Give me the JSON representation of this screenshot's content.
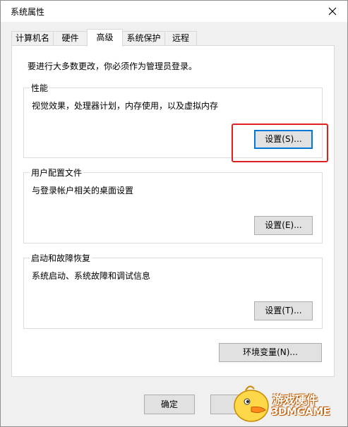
{
  "window": {
    "title": "系统属性"
  },
  "tabs": [
    {
      "label": "计算机名"
    },
    {
      "label": "硬件"
    },
    {
      "label": "高级"
    },
    {
      "label": "系统保护"
    },
    {
      "label": "远程"
    }
  ],
  "panel": {
    "intro": "要进行大多数更改，你必须作为管理员登录。",
    "performance": {
      "title": "性能",
      "desc": "视觉效果，处理器计划，内存使用，以及虚拟内存",
      "button": "设置(S)..."
    },
    "profiles": {
      "title": "用户配置文件",
      "desc": "与登录帐户相关的桌面设置",
      "button": "设置(E)..."
    },
    "startup": {
      "title": "启动和故障恢复",
      "desc": "系统启动、系统故障和调试信息",
      "button": "设置(T)..."
    },
    "env_button": "环境变量(N)..."
  },
  "footer": {
    "ok_label": "确定",
    "cancel_label": ""
  },
  "watermark": {
    "line1": "游戏硬件",
    "line2": "3DMGAME"
  },
  "colors": {
    "highlight": "#e02020",
    "focus": "#0078d7"
  }
}
